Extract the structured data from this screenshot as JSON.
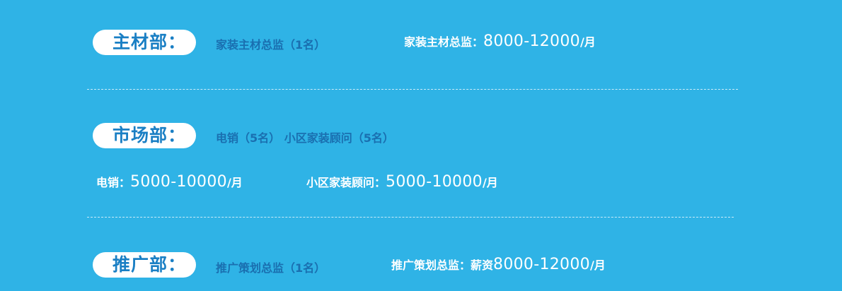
{
  "sections": [
    {
      "dept_label": "主材部：",
      "desc": "家装主材总监（1名）",
      "salaries": [
        {
          "label": "家装主材总监：",
          "amount": "8000-12000",
          "unit": "/月"
        }
      ]
    },
    {
      "dept_label": "市场部：",
      "desc": "电销（5名） 小区家装顾问（5名）",
      "salaries": [
        {
          "label": "电销：",
          "amount": "5000-10000",
          "unit": "/月"
        },
        {
          "label": "小区家装顾问：",
          "amount": "5000-10000",
          "unit": "/月"
        }
      ]
    },
    {
      "dept_label": "推广部：",
      "desc": "推广策划总监（1名）",
      "salaries": [
        {
          "label": "推广策划总监：薪资",
          "amount": "8000-12000",
          "unit": "/月"
        }
      ]
    }
  ],
  "colors": {
    "background": "#2fb3e6",
    "pill": "#ffffff",
    "pill_text": "#1a7fc4",
    "desc_text": "#1a6fb0",
    "salary_text": "#ffffff"
  }
}
